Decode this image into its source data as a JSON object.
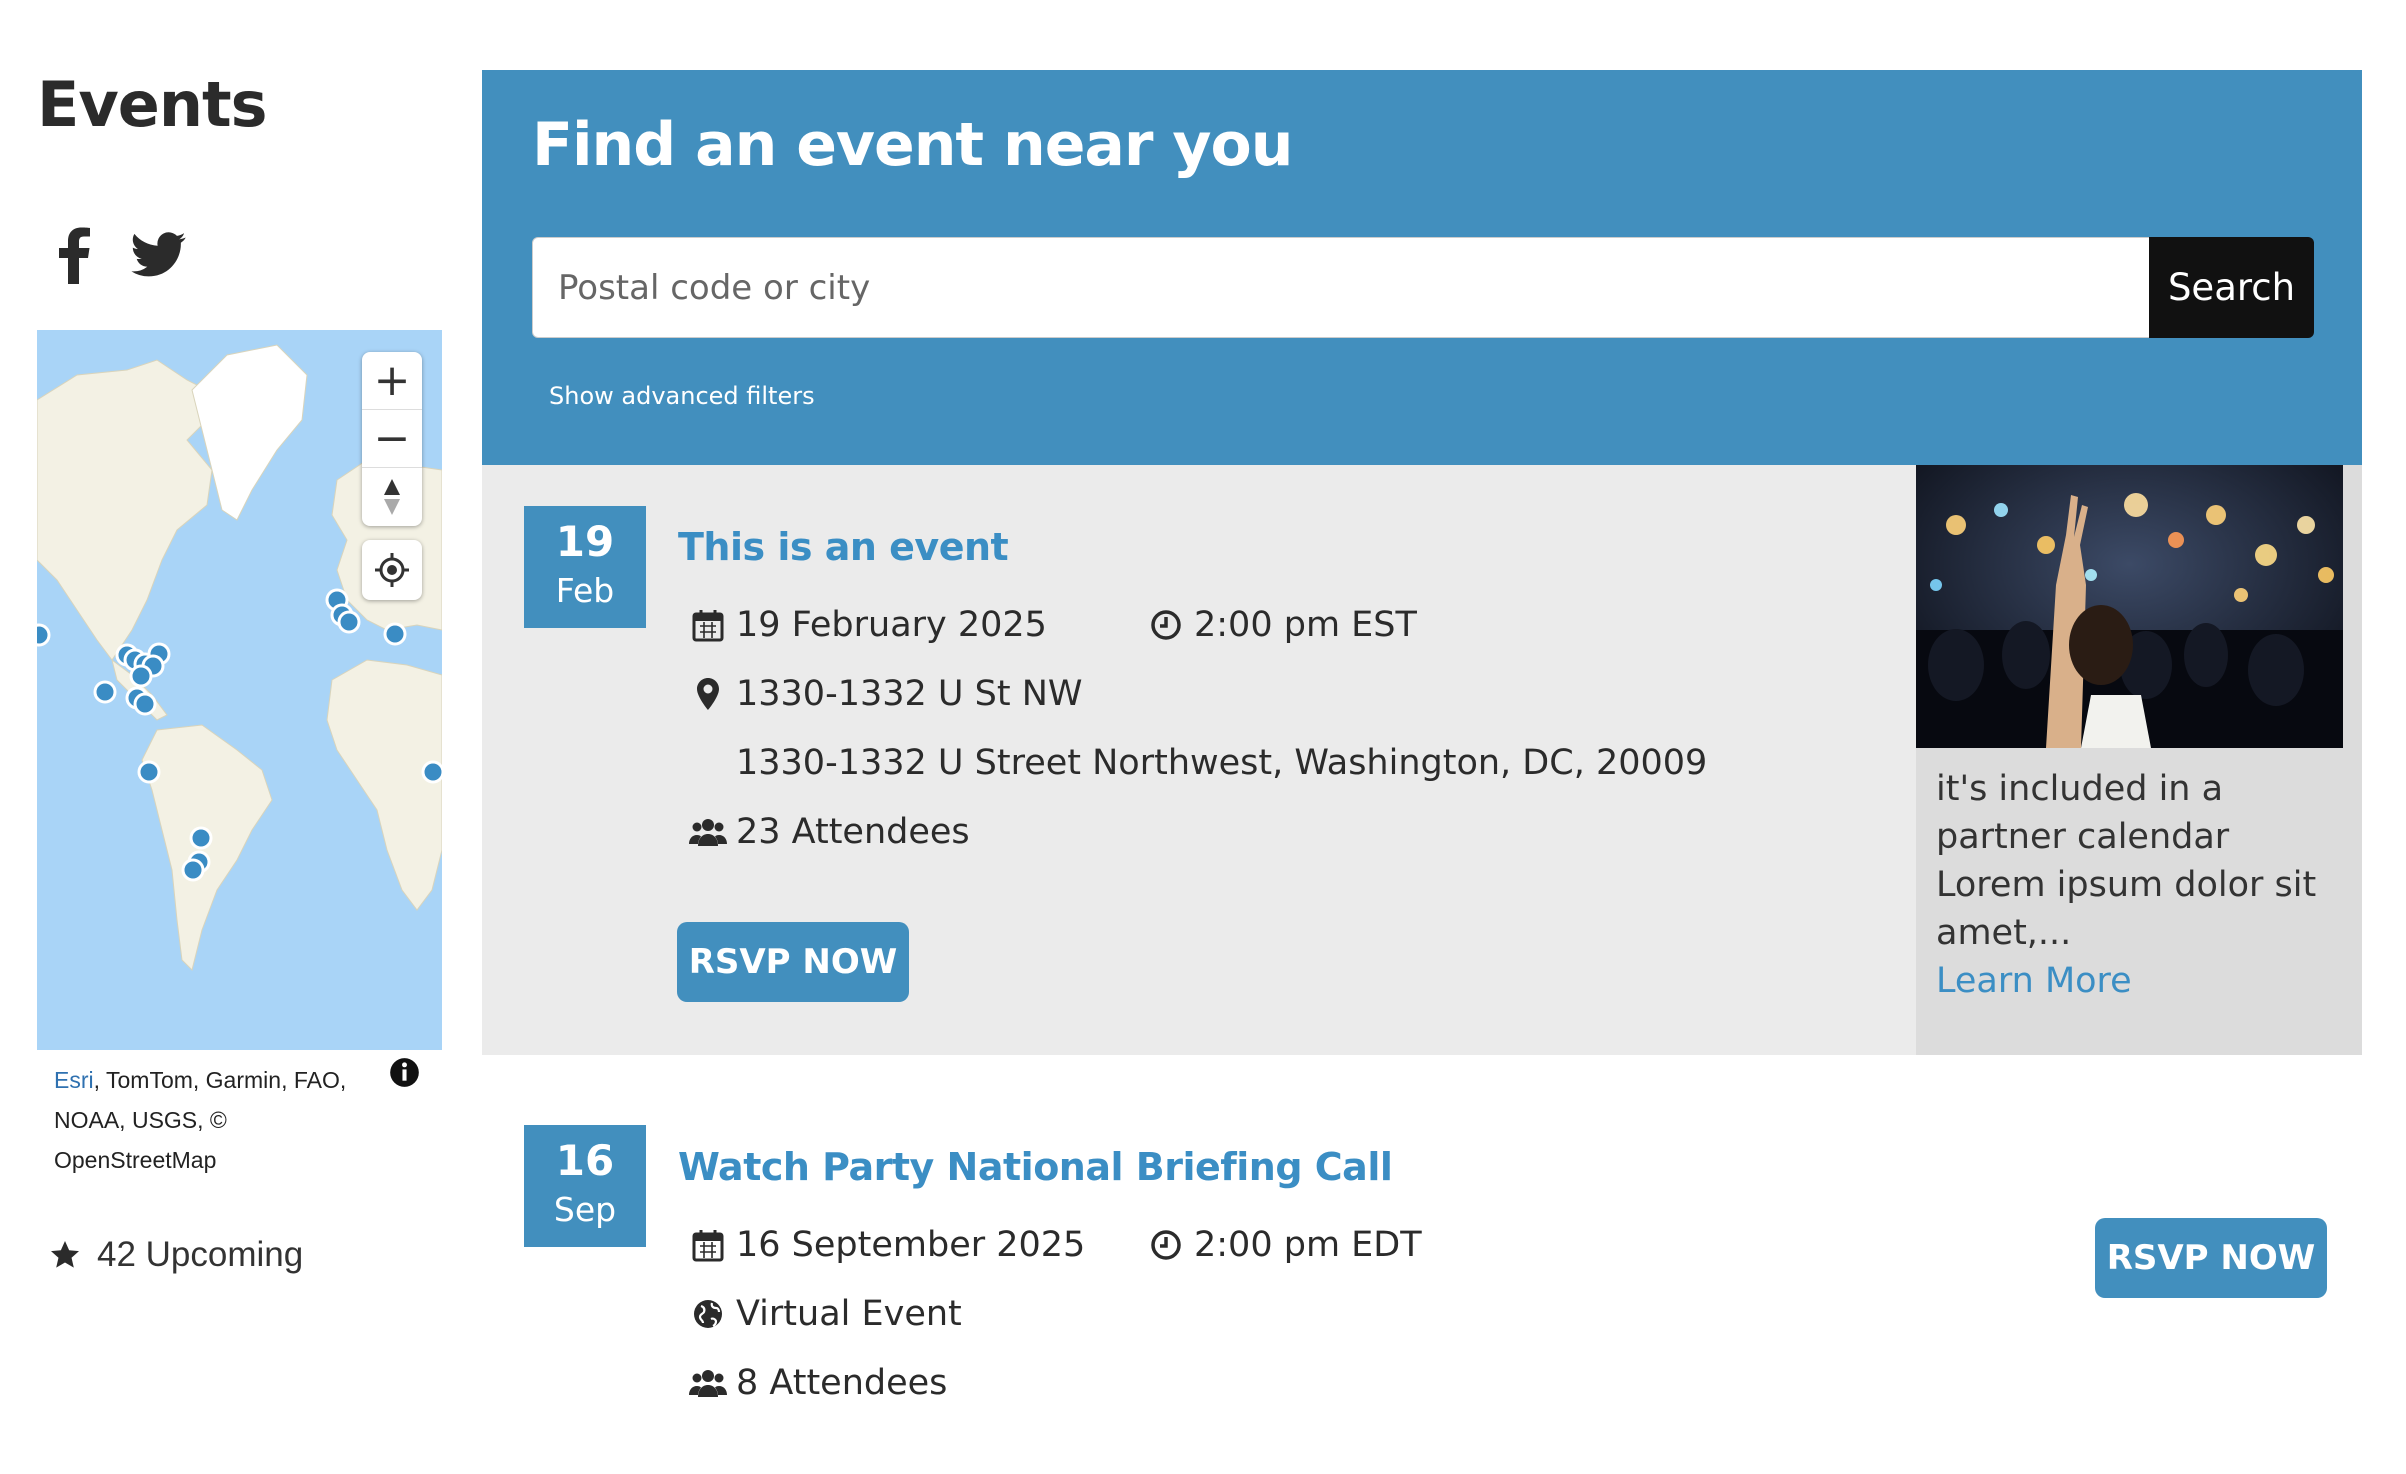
{
  "sidebar": {
    "title": "Events",
    "social": [
      {
        "name": "facebook-icon",
        "glyph": "f"
      },
      {
        "name": "twitter-icon",
        "glyph": "bird"
      }
    ],
    "map": {
      "zoom_in": "+",
      "zoom_out": "−",
      "attribution_link": "Esri",
      "attribution_text": ", TomTom, Garmin, FAO, NOAA, USGS, © OpenStreetMap"
    },
    "upcoming": "42 Upcoming"
  },
  "search": {
    "title": "Find an event near you",
    "placeholder": "Postal code or city",
    "button": "Search",
    "advanced": "Show advanced filters"
  },
  "events": [
    {
      "day": "19",
      "month": "Feb",
      "title": "This is an event",
      "date": "19 February 2025",
      "time": "2:00 pm EST",
      "location_name": "1330-1332 U St NW",
      "address": "1330-1332 U Street Northwest, Washington, DC, 20009",
      "attendees": "23 Attendees",
      "rsvp": "RSVP NOW",
      "partner_text": "it's included in a partner calendar Lorem ipsum dolor sit amet,...",
      "learn_more": "Learn More"
    },
    {
      "day": "16",
      "month": "Sep",
      "title": "Watch Party National Briefing Call",
      "date": "16 September 2025",
      "time": "2:00 pm EDT",
      "location_name": "Virtual Event",
      "attendees": "8 Attendees",
      "rsvp": "RSVP NOW"
    }
  ],
  "colors": {
    "brand_blue": "#428fbe",
    "link_blue": "#3b8ec4",
    "card_gray": "#ebebeb",
    "search_button": "#111111"
  }
}
